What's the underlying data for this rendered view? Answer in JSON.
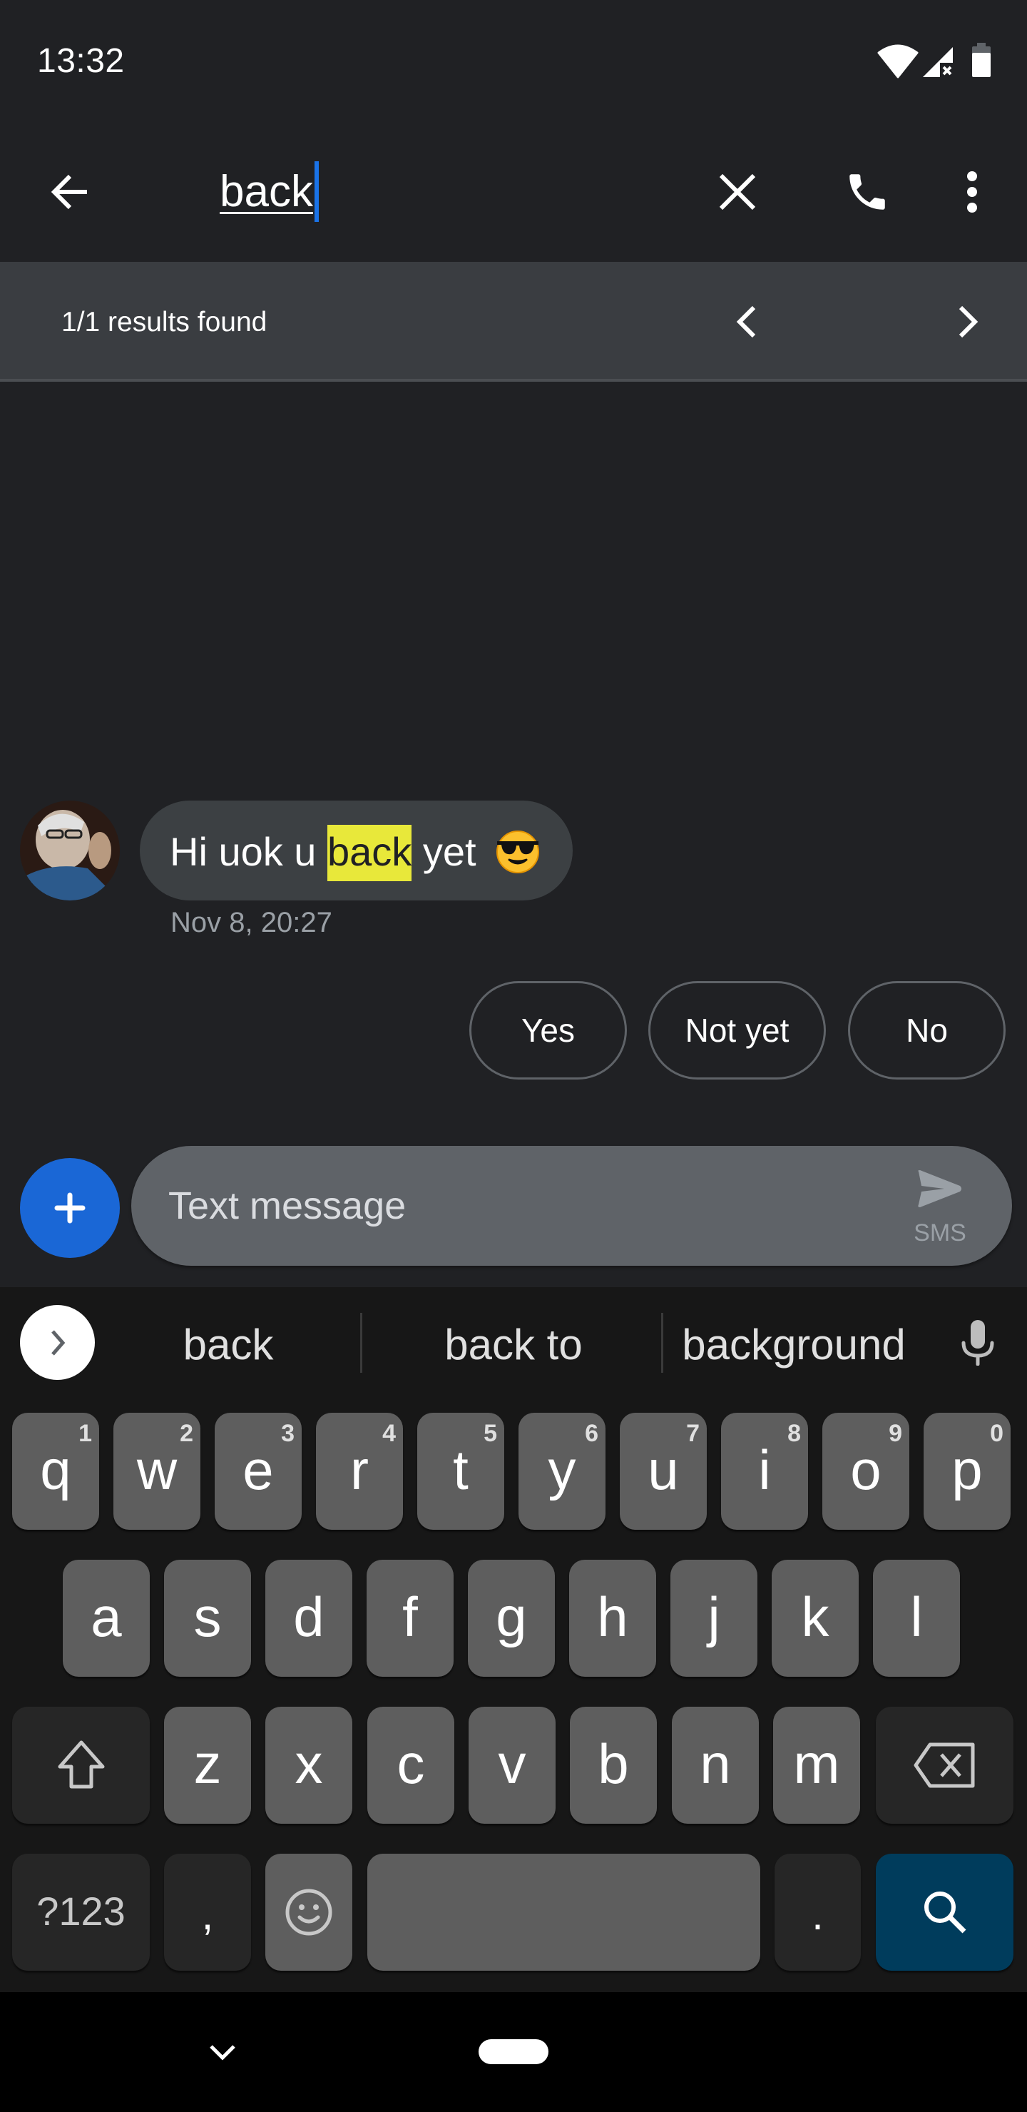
{
  "status_bar": {
    "time": "13:32",
    "icons": [
      "wifi-icon",
      "signal-no-sim-icon",
      "battery-icon"
    ]
  },
  "toolbar": {
    "back_icon": "arrow-left-icon",
    "search_query": "back",
    "clear_icon": "close-icon",
    "call_icon": "phone-icon",
    "more_icon": "more-vert-icon"
  },
  "search_results": {
    "summary": "1/1 results found",
    "prev_icon": "chevron-left-icon",
    "next_icon": "chevron-right-icon"
  },
  "conversation": {
    "messages": [
      {
        "direction": "incoming",
        "text_before": "Hi uok u ",
        "highlight": "back",
        "text_after": " yet  ",
        "emoji": "smiling-face-with-sunglasses",
        "timestamp": "Nov 8, 20:27"
      }
    ],
    "smart_replies": [
      "Yes",
      "Not yet",
      "No"
    ]
  },
  "compose": {
    "attach_icon": "plus-icon",
    "placeholder": "Text message",
    "value": "",
    "send_icon": "send-icon",
    "send_mode": "SMS"
  },
  "keyboard": {
    "suggestions": [
      "back",
      "back to",
      "background"
    ],
    "rows": [
      [
        {
          "key": "q",
          "hint": "1"
        },
        {
          "key": "w",
          "hint": "2"
        },
        {
          "key": "e",
          "hint": "3"
        },
        {
          "key": "r",
          "hint": "4"
        },
        {
          "key": "t",
          "hint": "5"
        },
        {
          "key": "y",
          "hint": "6"
        },
        {
          "key": "u",
          "hint": "7"
        },
        {
          "key": "i",
          "hint": "8"
        },
        {
          "key": "o",
          "hint": "9"
        },
        {
          "key": "p",
          "hint": "0"
        }
      ],
      [
        {
          "key": "a"
        },
        {
          "key": "s"
        },
        {
          "key": "d"
        },
        {
          "key": "f"
        },
        {
          "key": "g"
        },
        {
          "key": "h"
        },
        {
          "key": "j"
        },
        {
          "key": "k"
        },
        {
          "key": "l"
        }
      ],
      [
        {
          "key": "z"
        },
        {
          "key": "x"
        },
        {
          "key": "c"
        },
        {
          "key": "v"
        },
        {
          "key": "b"
        },
        {
          "key": "n"
        },
        {
          "key": "m"
        }
      ]
    ],
    "shift_icon": "shift-icon",
    "backspace_icon": "backspace-icon",
    "symbols_label": "?123",
    "comma": ",",
    "emoji_icon": "emoji-icon",
    "space_label": "",
    "period": ".",
    "action_icon": "search-icon"
  },
  "nav_bar": {
    "back_icon": "chevron-down-icon",
    "home_icon": "home-pill-icon"
  },
  "colors": {
    "background": "#202124",
    "results_bar": "#3a3d41",
    "bubble": "#3c4043",
    "highlight": "#e8e83a",
    "accent": "#1a73e8",
    "attach_button": "#1a67d6",
    "compose_field": "#5f6368",
    "keyboard_bg": "#171717",
    "key": "#5e5e5e",
    "function_key": "#262626",
    "action_key": "#003c5c"
  }
}
